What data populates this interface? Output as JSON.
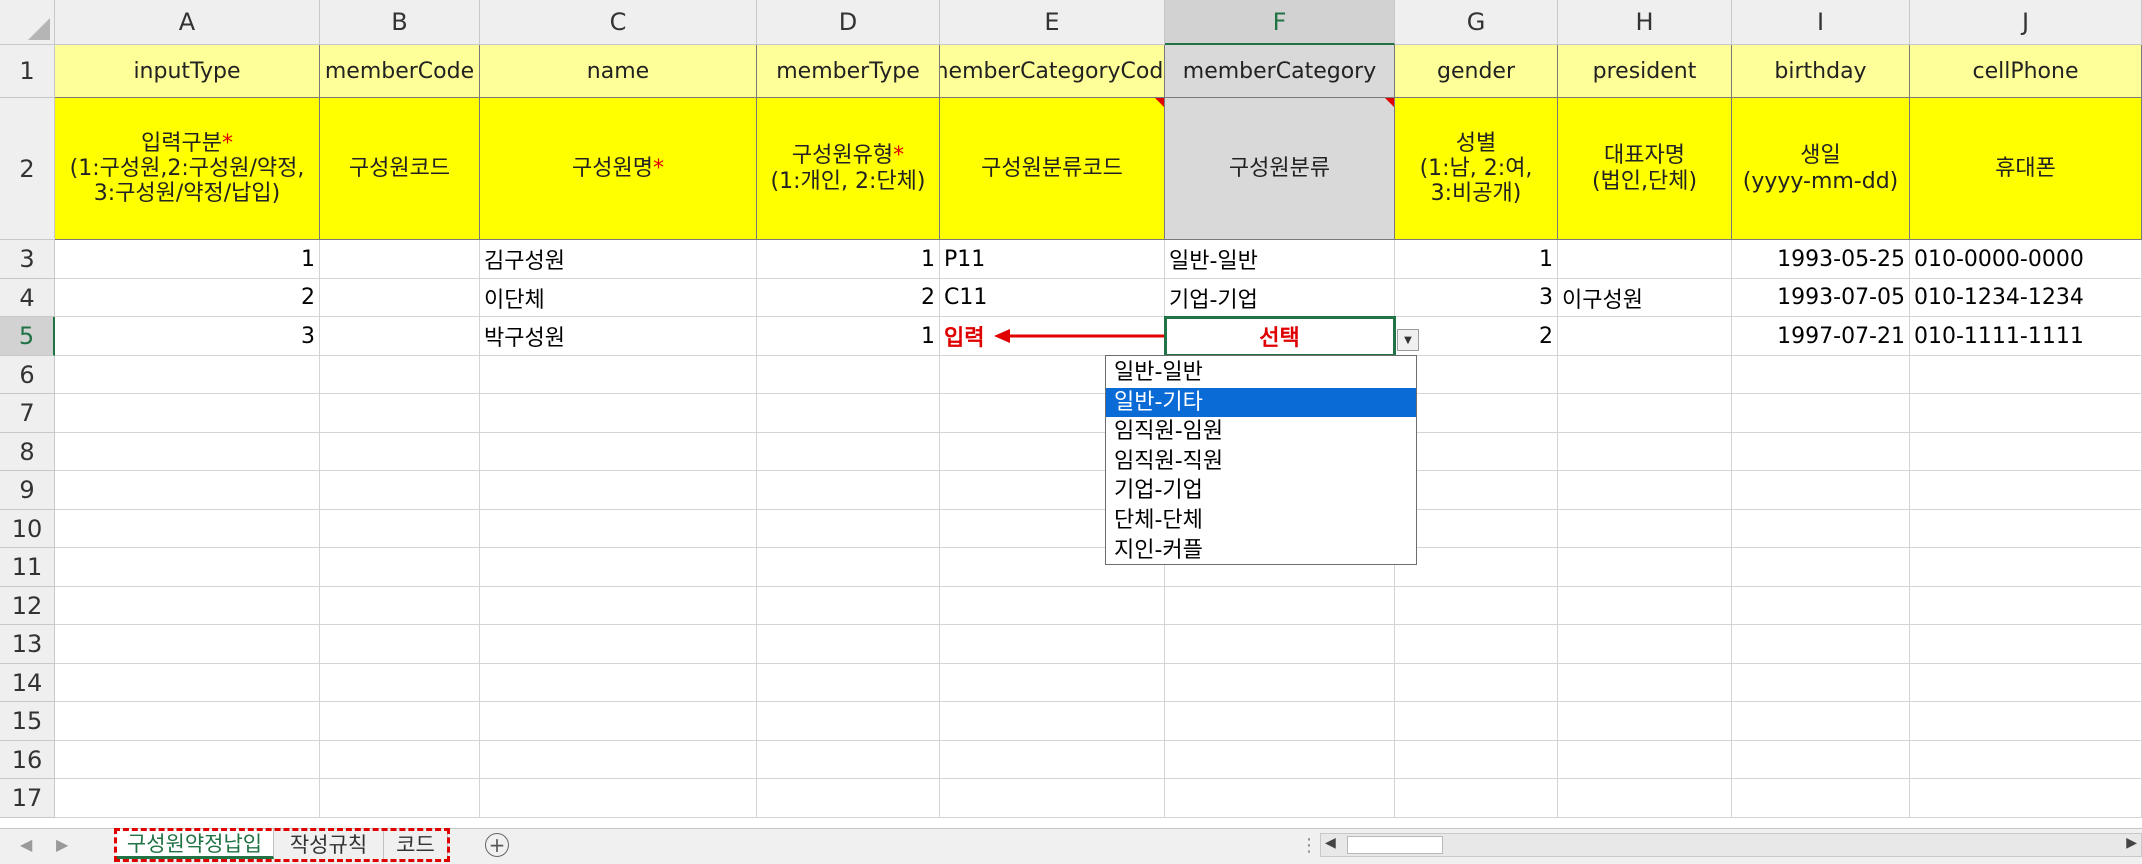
{
  "columns": [
    "A",
    "B",
    "C",
    "D",
    "E",
    "F",
    "G",
    "H",
    "I",
    "J"
  ],
  "row_numbers": [
    "1",
    "2",
    "3",
    "4",
    "5",
    "6",
    "7",
    "8",
    "9",
    "10",
    "11",
    "12",
    "13",
    "14",
    "15",
    "16",
    "17"
  ],
  "header_row1": [
    "inputType",
    "memberCode",
    "name",
    "memberType",
    "memberCategoryCode",
    "memberCategory",
    "gender",
    "president",
    "birthday",
    "cellPhone"
  ],
  "header_row2": {
    "a_lines": [
      "입력구분",
      "(1:구성원,2:구성원/약정,",
      "3:구성원/약정/납입)"
    ],
    "b": "구성원코드",
    "c": "구성원명",
    "d_lines": [
      "구성원유형",
      "(1:개인, 2:단체)"
    ],
    "e": "구성원분류코드",
    "f": "구성원분류",
    "g_lines": [
      "성별",
      "(1:남, 2:여,",
      "3:비공개)"
    ],
    "h_lines": [
      "대표자명",
      "(법인,단체)"
    ],
    "i_lines": [
      "생일",
      "(yyyy-mm-dd)"
    ],
    "j": "휴대폰",
    "required_mark": "*"
  },
  "rows": [
    {
      "inputType": "1",
      "memberCode": "",
      "name": "김구성원",
      "memberType": "1",
      "memberCategoryCode": "P11",
      "memberCategory": "일반-일반",
      "gender": "1",
      "president": "",
      "birthday": "1993-05-25",
      "cellPhone": "010-0000-0000"
    },
    {
      "inputType": "2",
      "memberCode": "",
      "name": "이단체",
      "memberType": "2",
      "memberCategoryCode": "C11",
      "memberCategory": "기업-기업",
      "gender": "3",
      "president": "이구성원",
      "birthday": "1993-07-05",
      "cellPhone": "010-1234-1234"
    },
    {
      "inputType": "3",
      "memberCode": "",
      "name": "박구성원",
      "memberType": "1",
      "memberCategoryCode": "입력",
      "memberCategory": "선택",
      "gender": "2",
      "president": "",
      "birthday": "1997-07-21",
      "cellPhone": "010-1111-1111"
    }
  ],
  "dropdown": {
    "options": [
      "일반-일반",
      "일반-기타",
      "임직원-임원",
      "임직원-직원",
      "기업-기업",
      "단체-단체",
      "지인-커플"
    ],
    "highlighted_index": 1
  },
  "sheet_tabs": [
    "구성원약정납입",
    "작성규칙",
    "코드"
  ],
  "active_tab_index": 0,
  "add_sheet_icon": "plus-circle-icon",
  "colors": {
    "accent": "#217346",
    "header_yellow": "#ffff00",
    "header_light_yellow": "#ffff99",
    "annotation_red": "#e00000",
    "selection_blue": "#0a6ad6"
  }
}
